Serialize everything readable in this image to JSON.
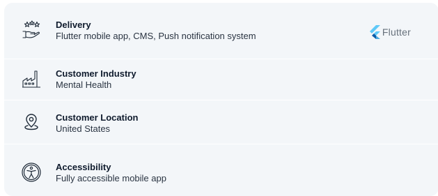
{
  "rows": [
    {
      "title": "Delivery",
      "description": "Flutter mobile app, CMS, Push notification system",
      "icon": "hand-stars-icon"
    },
    {
      "title": "Customer Industry",
      "description": "Mental Health",
      "icon": "factory-icon"
    },
    {
      "title": "Customer Location",
      "description": "United States",
      "icon": "location-pin-icon"
    },
    {
      "title": "Accessibility",
      "description": "Fully accessible mobile app",
      "icon": "accessibility-icon"
    }
  ],
  "tech_badge": {
    "label": "Flutter",
    "icon": "flutter-logo-icon"
  },
  "colors": {
    "card_bg": "#f3f6f9",
    "title": "#0f1b2d",
    "flutter_light": "#5fc9f8",
    "flutter_dark": "#0a5ca8"
  }
}
